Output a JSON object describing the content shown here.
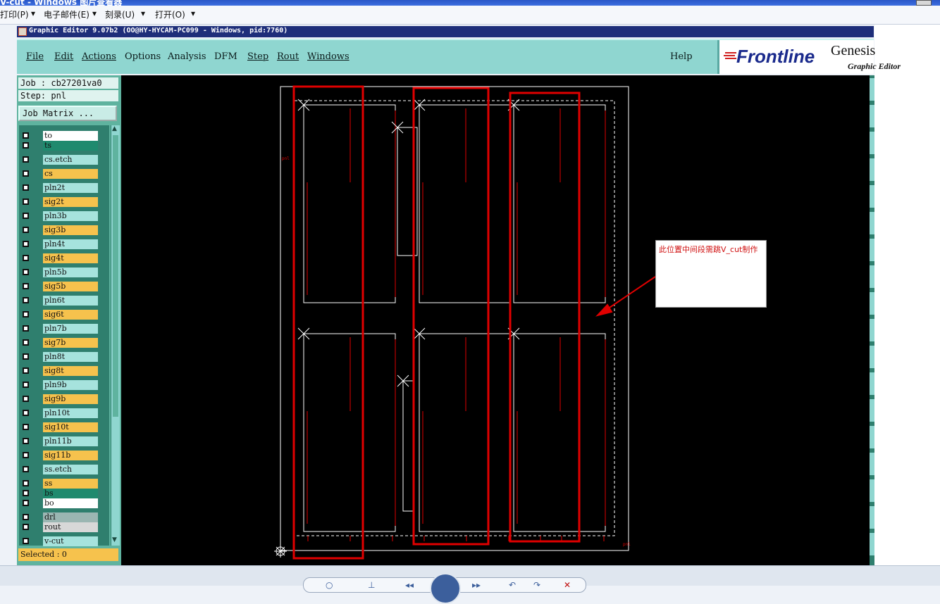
{
  "viewer": {
    "title": "V-cut - Windows 图片查看器",
    "menu": [
      "打印(P)",
      "电子邮件(E)",
      "刻录(U)",
      "打开(O)"
    ]
  },
  "editor": {
    "title": "Graphic Editor 9.07b2 (OO@HY-HYCAM-PC099 - Windows, pid:7760)",
    "menu": [
      "File",
      "Edit",
      "Actions",
      "Options",
      "Analysis",
      "DFM",
      "Step",
      "Rout",
      "Windows"
    ],
    "help": "Help",
    "logo": {
      "brand": "Frontline",
      "product": "Genesis",
      "subtitle": "Graphic Editor"
    }
  },
  "panel": {
    "job": "Job : cb27201va0",
    "step": "Step: pnl",
    "job_matrix_button": "Job Matrix ...",
    "selected": "Selected : 0"
  },
  "layers": [
    {
      "name": "to",
      "color": "#ffffff"
    },
    {
      "name": "ts",
      "color": "#1f8a6e"
    },
    {
      "name": "cs.etch",
      "color": "#a6e3dd"
    },
    {
      "name": "cs",
      "color": "#f6c24d"
    },
    {
      "name": "pln2t",
      "color": "#a6e3dd"
    },
    {
      "name": "sig2t",
      "color": "#f6c24d"
    },
    {
      "name": "pln3b",
      "color": "#a6e3dd"
    },
    {
      "name": "sig3b",
      "color": "#f6c24d"
    },
    {
      "name": "pln4t",
      "color": "#a6e3dd"
    },
    {
      "name": "sig4t",
      "color": "#f6c24d"
    },
    {
      "name": "pln5b",
      "color": "#a6e3dd"
    },
    {
      "name": "sig5b",
      "color": "#f6c24d"
    },
    {
      "name": "pln6t",
      "color": "#a6e3dd"
    },
    {
      "name": "sig6t",
      "color": "#f6c24d"
    },
    {
      "name": "pln7b",
      "color": "#a6e3dd"
    },
    {
      "name": "sig7b",
      "color": "#f6c24d"
    },
    {
      "name": "pln8t",
      "color": "#a6e3dd"
    },
    {
      "name": "sig8t",
      "color": "#f6c24d"
    },
    {
      "name": "pln9b",
      "color": "#a6e3dd"
    },
    {
      "name": "sig9b",
      "color": "#f6c24d"
    },
    {
      "name": "pln10t",
      "color": "#a6e3dd"
    },
    {
      "name": "sig10t",
      "color": "#f6c24d"
    },
    {
      "name": "pln11b",
      "color": "#a6e3dd"
    },
    {
      "name": "sig11b",
      "color": "#f6c24d"
    },
    {
      "name": "ss.etch",
      "color": "#a6e3dd"
    },
    {
      "name": "ss",
      "color": "#f6c24d"
    },
    {
      "name": "bs",
      "color": "#1f8a6e"
    },
    {
      "name": "bo",
      "color": "#ffffff"
    },
    {
      "name": "drl",
      "color": "#9bb6b2"
    },
    {
      "name": "rout",
      "color": "#d8d8d8"
    },
    {
      "name": "v-cut",
      "color": "#a6e3dd"
    }
  ],
  "annotation": {
    "text": "此位置中间段需跳V_cut制作",
    "highlight_color": "#e00000"
  }
}
